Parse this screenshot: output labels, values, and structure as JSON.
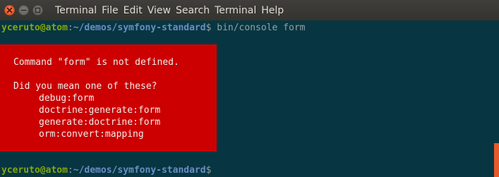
{
  "window": {
    "controls": {
      "close_icon": "close-icon",
      "minimize_icon": "minimize-icon",
      "maximize_icon": "maximize-icon"
    }
  },
  "menu": {
    "items": [
      {
        "label": "Terminal"
      },
      {
        "label": "File"
      },
      {
        "label": "Edit"
      },
      {
        "label": "View"
      },
      {
        "label": "Search"
      },
      {
        "label": "Terminal"
      },
      {
        "label": "Help"
      }
    ]
  },
  "terminal": {
    "prompt1": {
      "user_host": "yceruto@atom",
      "separator": ":",
      "path": "~/demos/symfony-standard",
      "dollar": "$",
      "command": " bin/console form"
    },
    "error": {
      "message": "Command \"form\" is not defined.",
      "suggestion_header": "Did you mean one of these?",
      "suggestions": [
        "debug:form",
        "doctrine:generate:form",
        "generate:doctrine:form",
        "orm:convert:mapping"
      ]
    },
    "prompt2": {
      "user_host": "yceruto@atom",
      "separator": ":",
      "path": "~/demos/symfony-standard",
      "dollar": "$"
    }
  },
  "colors": {
    "terminal_bg": "#073642",
    "error_bg": "#cc0000",
    "prompt_user": "#85a60a",
    "prompt_path": "#6c8cc4",
    "scroll_thumb": "#e65a2a"
  }
}
